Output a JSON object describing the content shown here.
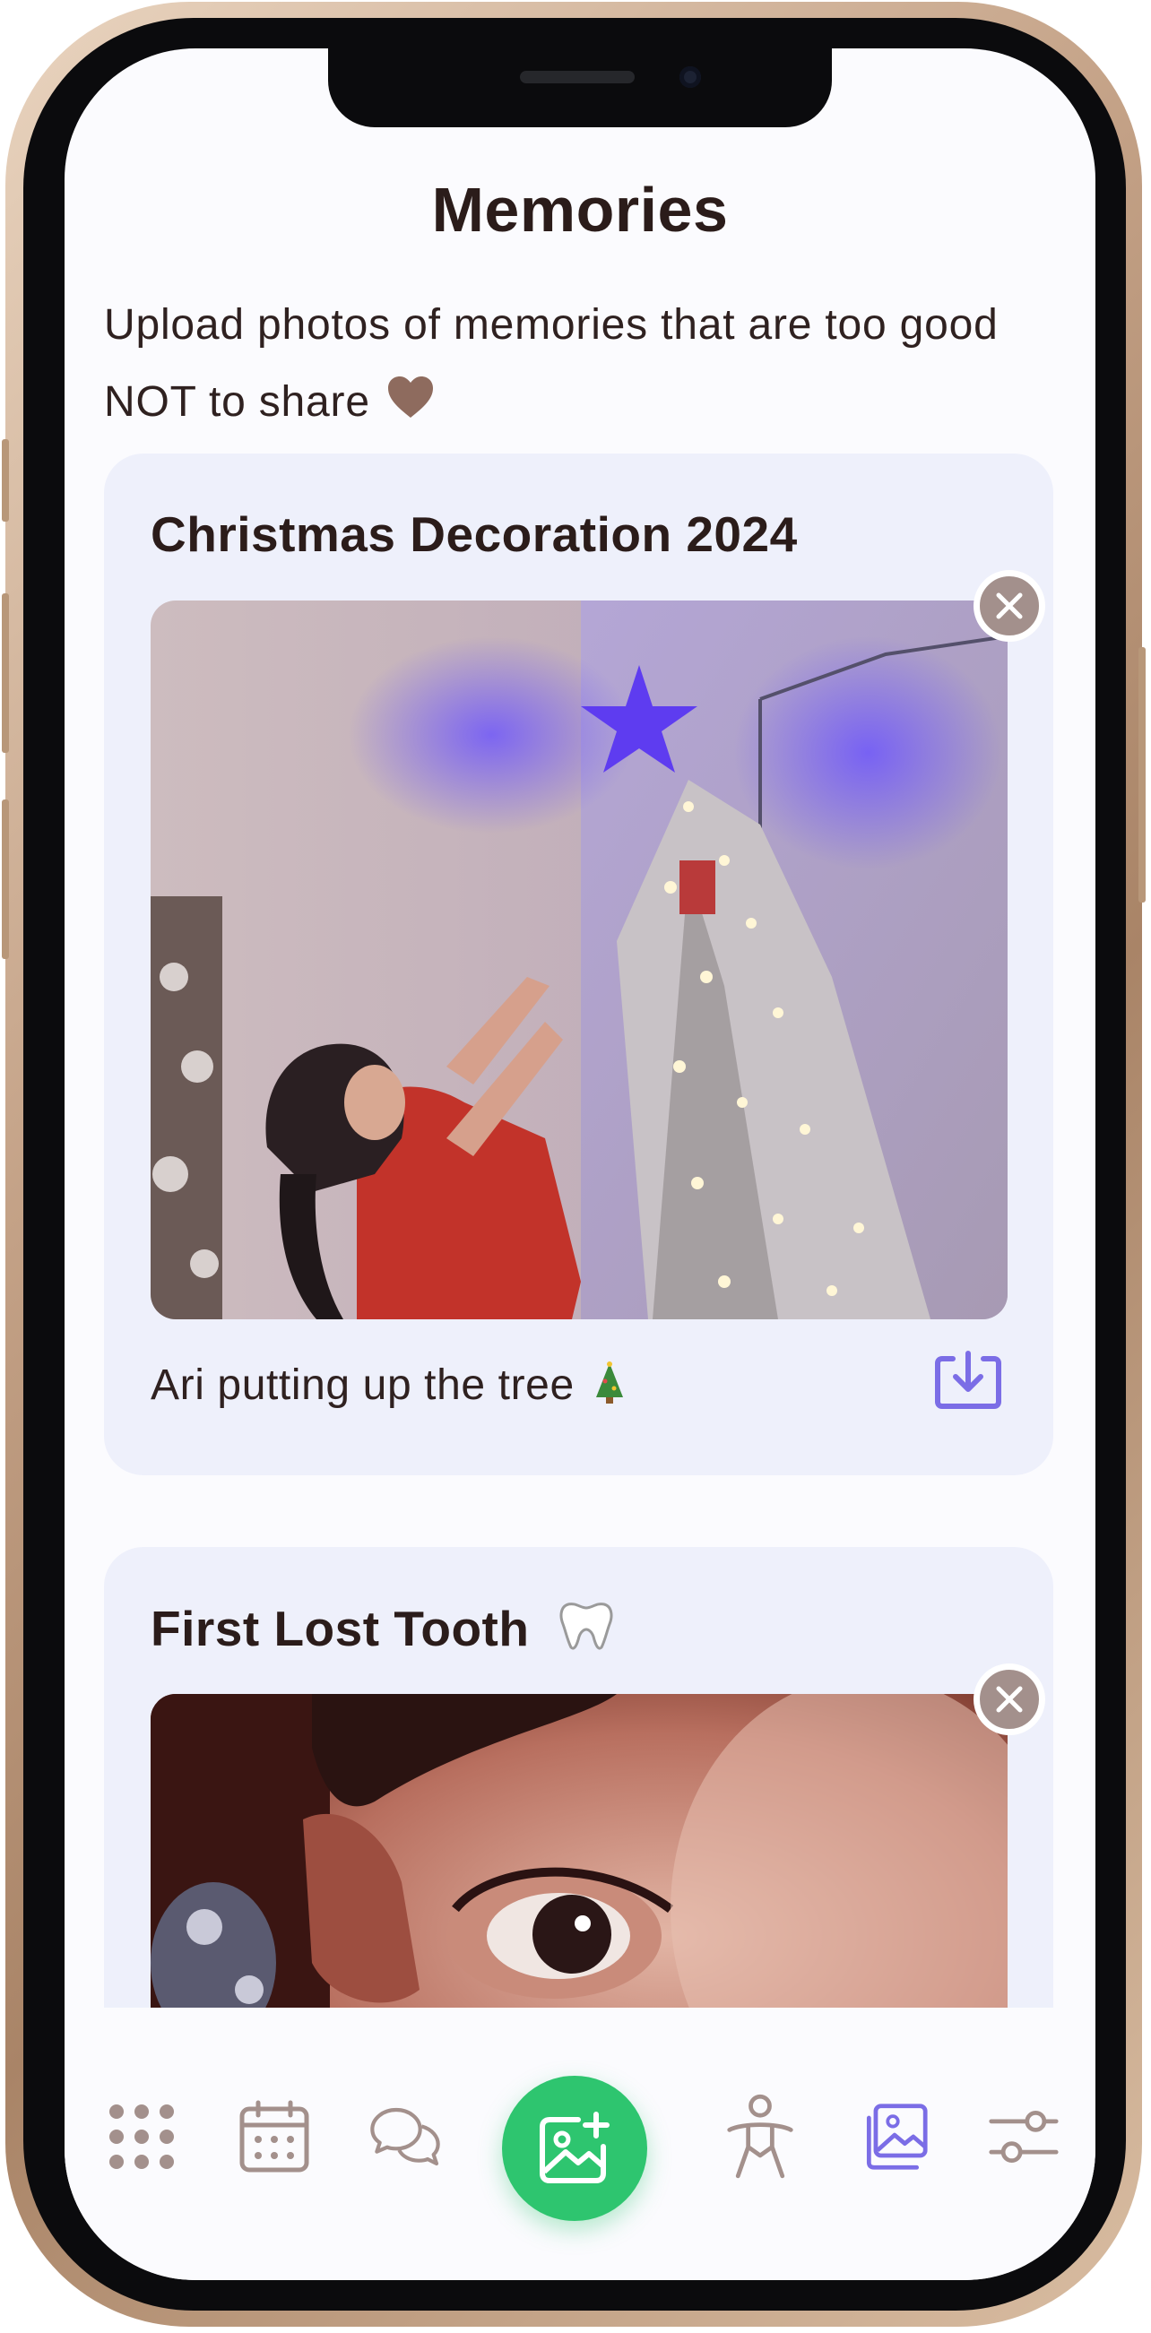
{
  "page": {
    "title": "Memories",
    "subtitle": "Upload photos of memories that are too good NOT to share"
  },
  "memories": [
    {
      "title": "Christmas Decoration 2024",
      "caption": "Ari putting up the tree"
    },
    {
      "title": "First Lost Tooth"
    }
  ],
  "colors": {
    "accent_purple": "#7b6de6",
    "action_green": "#2ec56f",
    "card_bg": "#eef0fb",
    "muted_icon": "#a3908c",
    "text_dark": "#2b1c1a"
  },
  "nav": {
    "items": [
      {
        "icon": "grid-icon"
      },
      {
        "icon": "calendar-icon"
      },
      {
        "icon": "chat-icon"
      },
      {
        "icon": "add-photo-icon"
      },
      {
        "icon": "person-icon"
      },
      {
        "icon": "gallery-icon",
        "active": true
      },
      {
        "icon": "settings-sliders-icon"
      }
    ]
  }
}
